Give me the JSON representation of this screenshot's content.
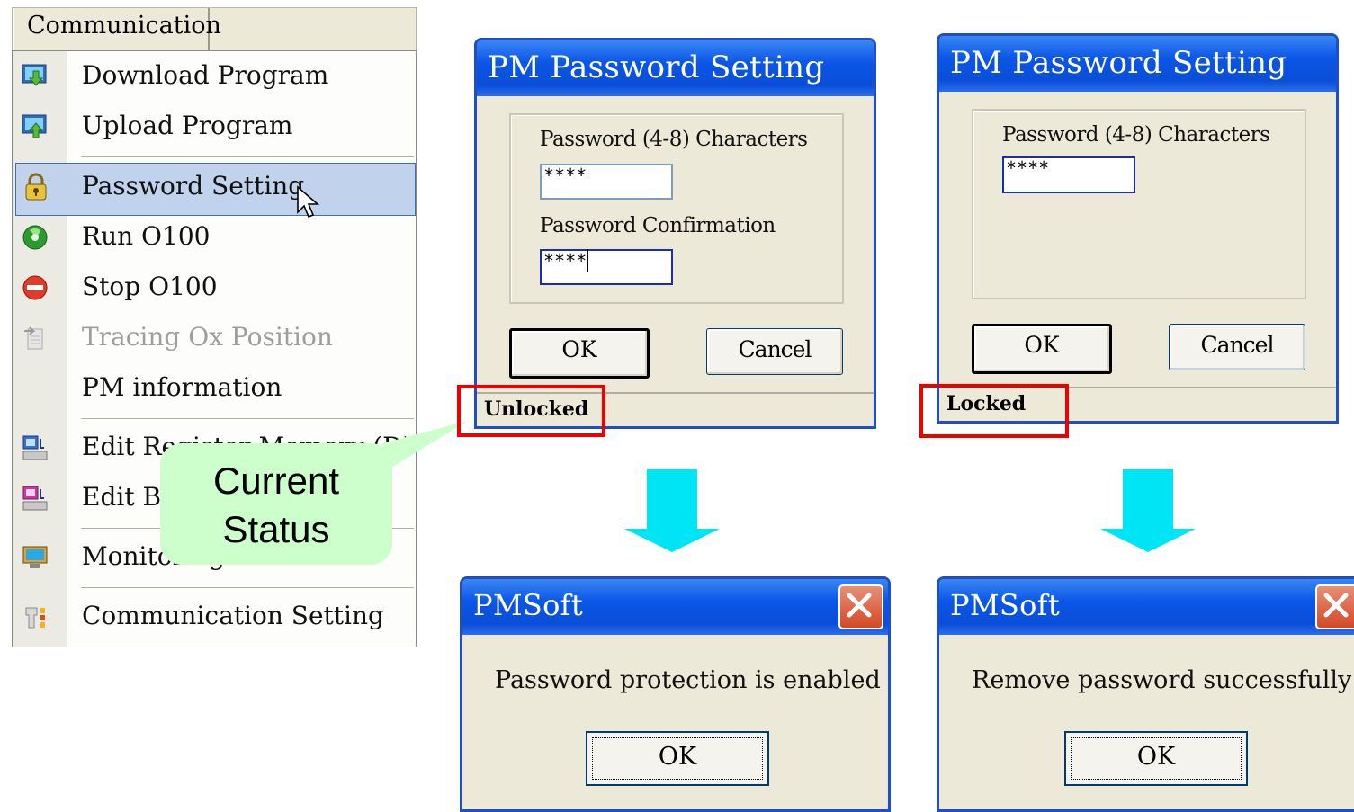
{
  "menu": {
    "tab_label": "Communication",
    "items": [
      {
        "label": "Download Program",
        "icon": "download-program-icon"
      },
      {
        "label": "Upload Program",
        "icon": "upload-program-icon"
      },
      {
        "label": "Password Setting",
        "icon": "lock-icon",
        "selected": true
      },
      {
        "label": "Run O100",
        "icon": "run-icon"
      },
      {
        "label": "Stop O100",
        "icon": "stop-icon"
      },
      {
        "label": "Tracing Ox Position",
        "icon": "tracing-icon",
        "disabled": true
      },
      {
        "label": "PM information"
      },
      {
        "label": "Edit Register Memory (D)",
        "icon": "edit-register-icon",
        "partially_hidden": true
      },
      {
        "label": "Edit Bit",
        "icon": "edit-bit-icon",
        "partially_hidden": true
      },
      {
        "label": "Monitoring",
        "icon": "monitor-icon"
      },
      {
        "label": "Communication Setting",
        "icon": "communication-setting-icon"
      }
    ]
  },
  "callout": {
    "text_line1": "Current",
    "text_line2": "Status",
    "color": "#ccffcc"
  },
  "dialog_unlocked": {
    "title": "PM Password Setting",
    "password_label": "Password (4-8) Characters",
    "password_value": "****",
    "confirm_label": "Password Confirmation",
    "confirm_value": "****",
    "ok_label": "OK",
    "cancel_label": "Cancel",
    "status": "Unlocked"
  },
  "dialog_locked": {
    "title": "PM Password Setting",
    "password_label": "Password (4-8) Characters",
    "password_value": "****",
    "ok_label": "OK",
    "cancel_label": "Cancel",
    "status": "Locked"
  },
  "message_enabled": {
    "title": "PMSoft",
    "message": "Password protection is enabled",
    "ok_label": "OK"
  },
  "message_removed": {
    "title": "PMSoft",
    "message": "Remove password successfully",
    "ok_label": "OK"
  },
  "colors": {
    "highlight": "#ee0000",
    "arrow": "#00e5f5",
    "title_blue": "#0a56e6",
    "menu_selected": "#c0d2ec"
  }
}
